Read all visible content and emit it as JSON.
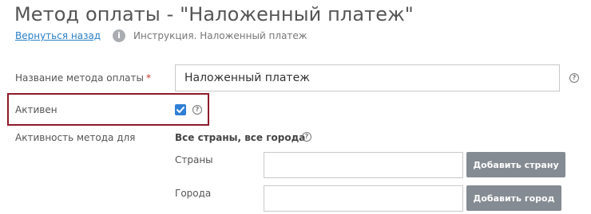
{
  "page": {
    "title": "Метод оплаты - \"Наложенный платеж\"",
    "back_link": "Вернуться назад",
    "info_icon_glyph": "i",
    "instruction": "Инструкция. Наложенный платеж"
  },
  "form": {
    "name_label": "Название метода оплаты",
    "required_mark": "*",
    "name_value": "Наложенный платеж",
    "active_label": "Активен",
    "active_checked": true,
    "scope_label": "Активность метода для",
    "scope_value": "Все страны, все города",
    "countries_label": "Страны",
    "countries_value": "",
    "add_country_button": "Добавить страну",
    "cities_label": "Города",
    "cities_value": "",
    "add_city_button": "Добавить город",
    "help_glyph": "?"
  },
  "colors": {
    "link": "#2b80c8",
    "checkbox": "#2f7fd6",
    "highlight_border": "#8e1a2a",
    "button": "#858b92",
    "required": "#c0392b"
  }
}
